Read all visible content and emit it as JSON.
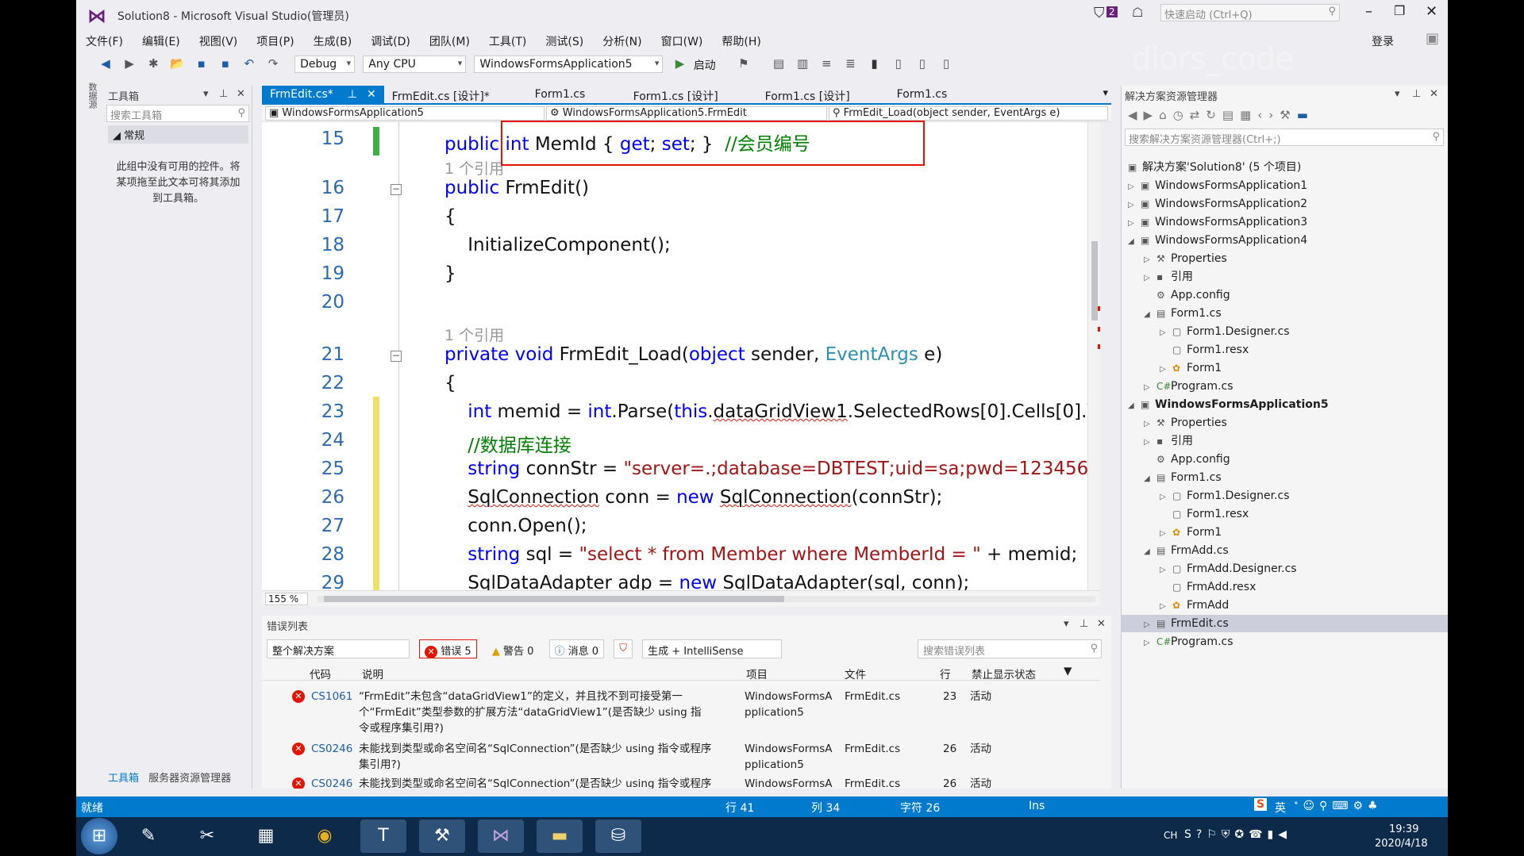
{
  "window": {
    "title": "Solution8 - Microsoft Visual Studio(管理员)",
    "notif_count": "2",
    "quick_launch": "快速启动 (Ctrl+Q)",
    "login": "登录",
    "watermark": "diors_code"
  },
  "menu": [
    "文件(F)",
    "编辑(E)",
    "视图(V)",
    "项目(P)",
    "生成(B)",
    "调试(D)",
    "团队(M)",
    "工具(T)",
    "测试(S)",
    "分析(N)",
    "窗口(W)",
    "帮助(H)"
  ],
  "toolbar": {
    "config": "Debug",
    "platform": "Any CPU",
    "startup": "WindowsFormsApplication5",
    "start": "启动"
  },
  "toolbox": {
    "title": "工具箱",
    "search": "搜索工具箱",
    "group": "常规",
    "empty_text": "此组中没有可用的控件。将某项拖至此文本可将其添加到工具箱。",
    "tab1": "工具箱",
    "tab2": "服务器资源管理器"
  },
  "tabs": [
    "FrmEdit.cs*",
    "FrmEdit.cs [设计]*",
    "Form1.cs",
    "Form1.cs [设计]",
    "Form1.cs [设计]",
    "Form1.cs"
  ],
  "nav": {
    "project": "WindowsFormsApplication5",
    "class": "WindowsFormsApplication5.FrmEdit",
    "member": "FrmEdit_Load(object sender, EventArgs e)"
  },
  "code": {
    "l15": "15",
    "l16": "16",
    "l17": "17",
    "l18": "18",
    "l19": "19",
    "l20": "20",
    "l21": "21",
    "l22": "22",
    "l23": "23",
    "l24": "24",
    "l25": "25",
    "l26": "26",
    "l27": "27",
    "l28": "28",
    "l29": "29",
    "refs1": "1 个引用",
    "refs2": "1 个引用",
    "memid_comment": "//会员编号",
    "db_comment": "//数据库连接",
    "connstr": "\"server=.;database=DBTEST;uid=sa;pwd=123456\"",
    "sql": "\"select * from Member where MemberId = \""
  },
  "zoom": "155 %",
  "errors": {
    "title": "错误列表",
    "scope": "整个解决方案",
    "errors_btn": "错误 5",
    "warnings_btn": "警告 0",
    "messages_btn": "消息 0",
    "source": "生成 + IntelliSense",
    "search": "搜索错误列表",
    "columns": [
      "代码",
      "说明",
      "项目",
      "文件",
      "行",
      "禁止显示状态"
    ],
    "rows": [
      {
        "code": "CS1061",
        "desc1": "“FrmEdit”未包含“dataGridView1”的定义，并且找不到可接受第一",
        "desc2": "个“FrmEdit”类型参数的扩展方法“dataGridView1”(是否缺少 using 指",
        "desc3": "令或程序集引用?)",
        "proj1": "WindowsFormsA",
        "proj2": "pplication5",
        "file": "FrmEdit.cs",
        "line": "23",
        "state": "活动"
      },
      {
        "code": "CS0246",
        "desc1": "未能找到类型或命名空间名“SqlConnection”(是否缺少 using 指令或程序",
        "desc2": "集引用?)",
        "desc3": "",
        "proj1": "WindowsFormsA",
        "proj2": "pplication5",
        "file": "FrmEdit.cs",
        "line": "26",
        "state": "活动"
      },
      {
        "code": "CS0246",
        "desc1": "未能找到类型或命名空间名“SqlConnection”(是否缺少 using 指令或程序",
        "desc2": "",
        "desc3": "",
        "proj1": "WindowsFormsA",
        "proj2": "",
        "file": "FrmEdit.cs",
        "line": "26",
        "state": "活动"
      }
    ]
  },
  "solution": {
    "title": "解决方案资源管理器",
    "search": "搜索解决方案资源管理器(Ctrl+;)",
    "items": [
      "解决方案'Solution8' (5 个项目)",
      "WindowsFormsApplication1",
      "WindowsFormsApplication2",
      "WindowsFormsApplication3",
      "WindowsFormsApplication4",
      "Properties",
      "引用",
      "App.config",
      "Form1.cs",
      "Form1.Designer.cs",
      "Form1.resx",
      "Form1",
      "Program.cs",
      "WindowsFormsApplication5",
      "Properties",
      "引用",
      "App.config",
      "Form1.cs",
      "Form1.Designer.cs",
      "Form1.resx",
      "Form1",
      "FrmAdd.cs",
      "FrmAdd.Designer.cs",
      "FrmAdd.resx",
      "FrmAdd",
      "FrmEdit.cs",
      "Program.cs"
    ]
  },
  "status": {
    "ready": "就绪",
    "row": "行 41",
    "col": "列 34",
    "char": "字符 26",
    "mode": "Ins"
  },
  "taskbar": {
    "clock_time": "19:39",
    "clock_date": "2020/4/18",
    "ime": "英",
    "lang": "CH"
  }
}
